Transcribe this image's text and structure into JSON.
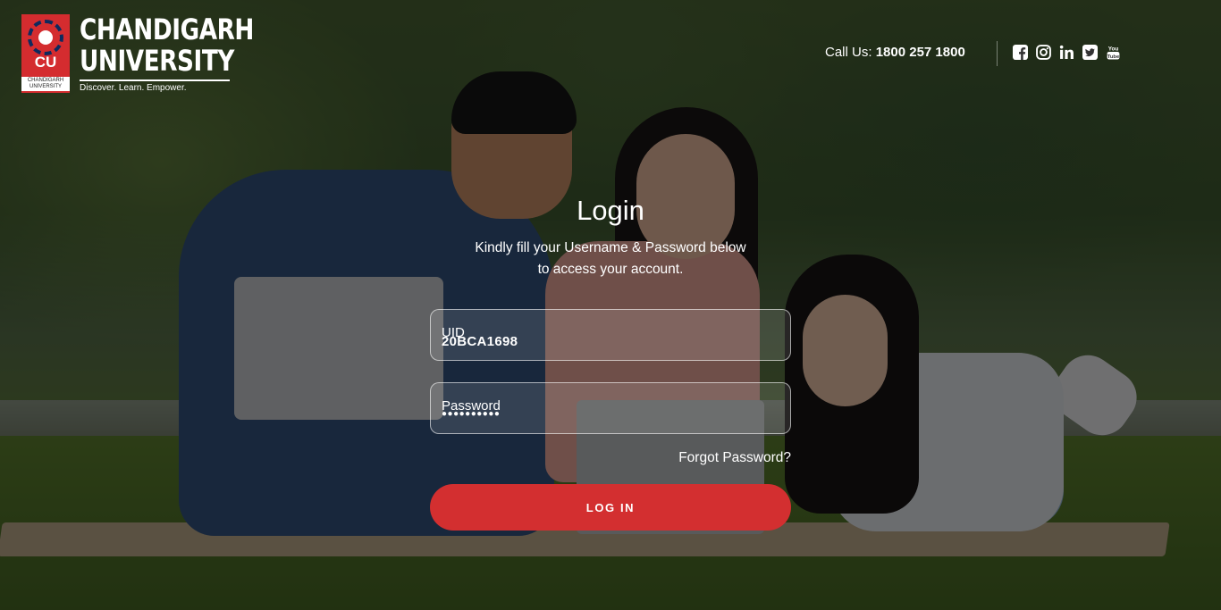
{
  "brand": {
    "emblem_text": "CU",
    "emblem_subtext": "CHANDIGARH UNIVERSITY",
    "name_line1": "CHANDIGARH",
    "name_line2": "UNIVERSITY",
    "tagline": "Discover. Learn. Empower.",
    "primary_color": "#d42c2f"
  },
  "header": {
    "call_label": "Call Us:",
    "phone": "1800 257 1800",
    "social_icons": [
      "facebook-icon",
      "instagram-icon",
      "linkedin-icon",
      "twitter-icon",
      "youtube-icon"
    ]
  },
  "login": {
    "title": "Login",
    "subtitle_line1": "Kindly fill your Username & Password below",
    "subtitle_line2": "to access your account.",
    "uid_label": "UID",
    "uid_value": "20BCA1698",
    "password_label": "Password",
    "password_mask": "●●●●●●●●●●",
    "forgot_password": "Forgot Password?",
    "button_label": "LOG IN",
    "button_color": "#d32f30"
  }
}
